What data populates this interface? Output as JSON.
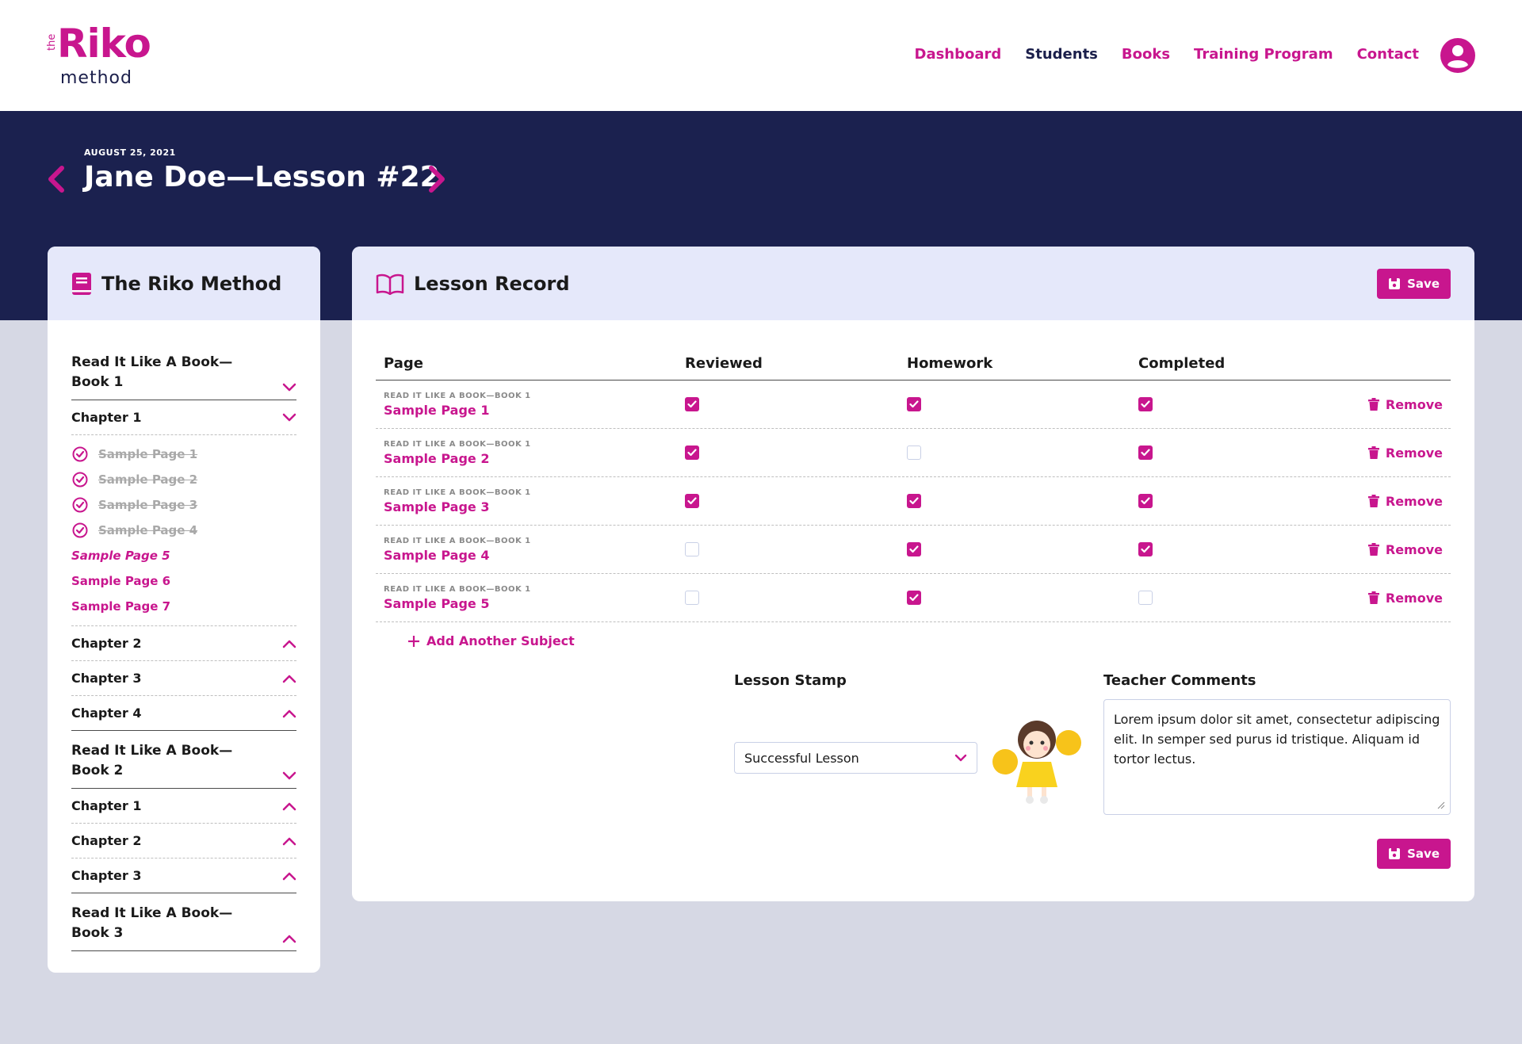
{
  "brand": {
    "the": "the",
    "name": "Riko",
    "sub": "method"
  },
  "nav": [
    {
      "label": "Dashboard",
      "active": false
    },
    {
      "label": "Students",
      "active": true
    },
    {
      "label": "Books",
      "active": false
    },
    {
      "label": "Training Program",
      "active": false
    },
    {
      "label": "Contact",
      "active": false
    }
  ],
  "lesson": {
    "date": "AUGUST 25, 2021",
    "title": "Jane Doe—Lesson #22"
  },
  "sidebar": {
    "title": "The Riko Method",
    "book1": "Read It Like A Book—Book 1",
    "book1_chapters": [
      "Chapter 1",
      "Chapter 2",
      "Chapter 3",
      "Chapter 4"
    ],
    "pages": [
      {
        "label": "Sample Page 1",
        "state": "done"
      },
      {
        "label": "Sample Page 2",
        "state": "done"
      },
      {
        "label": "Sample Page 3",
        "state": "done"
      },
      {
        "label": "Sample Page 4",
        "state": "done"
      },
      {
        "label": "Sample Page 5",
        "state": "current"
      },
      {
        "label": "Sample Page 6",
        "state": "todo"
      },
      {
        "label": "Sample Page 7",
        "state": "todo"
      }
    ],
    "book2": "Read It Like A Book—Book 2",
    "book2_chapters": [
      "Chapter 1",
      "Chapter 2",
      "Chapter 3"
    ],
    "book3": "Read It Like A Book—Book 3"
  },
  "record": {
    "title": "Lesson Record",
    "save_label": "Save",
    "columns": [
      "Page",
      "Reviewed",
      "Homework",
      "Completed"
    ],
    "rows": [
      {
        "book": "READ IT LIKE A BOOK—BOOK 1",
        "page": "Sample Page 1",
        "reviewed": true,
        "homework": true,
        "completed": true,
        "action": "Remove"
      },
      {
        "book": "READ IT LIKE A BOOK—BOOK 1",
        "page": "Sample Page 2",
        "reviewed": true,
        "homework": false,
        "completed": true,
        "action": "Remove"
      },
      {
        "book": "READ IT LIKE A BOOK—BOOK 1",
        "page": "Sample Page 3",
        "reviewed": true,
        "homework": true,
        "completed": true,
        "action": "Remove"
      },
      {
        "book": "READ IT LIKE A BOOK—BOOK 1",
        "page": "Sample Page 4",
        "reviewed": false,
        "homework": true,
        "completed": true,
        "action": "Remove"
      },
      {
        "book": "READ IT LIKE A BOOK—BOOK 1",
        "page": "Sample Page 5",
        "reviewed": false,
        "homework": true,
        "completed": false,
        "action": "Remove"
      }
    ],
    "add_label": "Add Another Subject",
    "stamp_label": "Lesson Stamp",
    "stamp_value": "Successful Lesson",
    "comments_label": "Teacher Comments",
    "comments_value": "Lorem ipsum dolor sit amet, consectetur adipiscing elit. In semper sed purus id tristique. Aliquam id tortor lectus."
  },
  "colors": {
    "accent": "#c8168e",
    "navy": "#1b214f",
    "header_tint": "#e5e8fa",
    "page_bg": "#d6d8e4"
  }
}
